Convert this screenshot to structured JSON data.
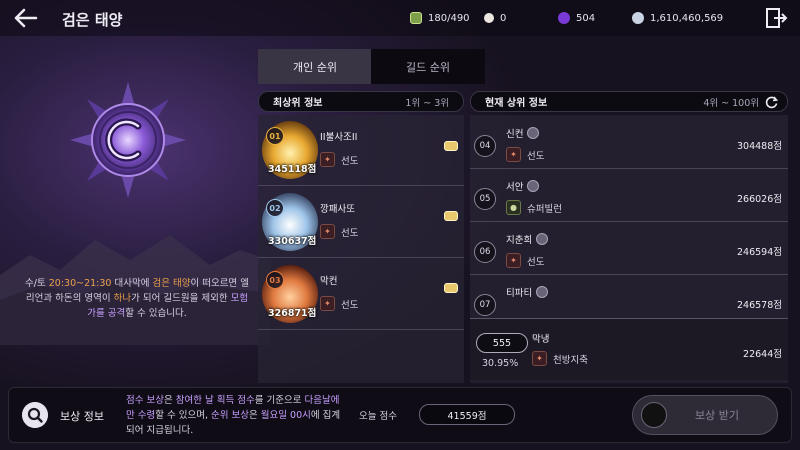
{
  "header": {
    "title": "검은 태양",
    "resources": [
      {
        "icon": "energy-icon",
        "value": "180/490"
      },
      {
        "icon": "pearl-icon",
        "value": "0"
      },
      {
        "icon": "gem-icon",
        "value": "504"
      },
      {
        "icon": "silver-icon",
        "value": "1,610,460,569"
      }
    ]
  },
  "description": {
    "line1a": "수/토 ",
    "time": "20:30~21:30",
    " line1c": "",
    "p1": "수/토 ",
    "p2": "20:30~21:30",
    "p3": " 대사막에 ",
    "p4": "검은 태양",
    "p5": "이 떠오르면 엘리언과 하돈의 영역이 ",
    "p6": "하나",
    "p7": "가 되어 길드원을 제외한 ",
    "p8": "모험가를 공격",
    "p9": "할 수 있습니다."
  },
  "tabs": [
    {
      "label": "개인 순위"
    },
    {
      "label": "길드 순위"
    }
  ],
  "top_panel": {
    "title": "최상위 정보",
    "range": "1위 ~ 3위"
  },
  "current_panel": {
    "title": "현재 상위 정보",
    "range": "4위 ~ 100위"
  },
  "top_ranks": [
    {
      "rank": "01",
      "name": "II불사조II",
      "points": "345118점",
      "class": "선도",
      "color": "#e8b040"
    },
    {
      "rank": "02",
      "name": "깡패사또",
      "points": "330637점",
      "class": "선도",
      "color": "#9ec4e8"
    },
    {
      "rank": "03",
      "name": "막컨",
      "points": "326871점",
      "class": "선도",
      "color": "#e07a40"
    }
  ],
  "current_ranks": [
    {
      "rank": "04",
      "name": "신컨",
      "class": "선도",
      "points": "304488점"
    },
    {
      "rank": "05",
      "name": "서안",
      "class": "슈퍼빌런",
      "points": "266026점"
    },
    {
      "rank": "06",
      "name": "지춘희",
      "class": "선도",
      "points": "246594점"
    },
    {
      "rank": "07",
      "name": "티파티",
      "class": "",
      "points": "246578점"
    }
  ],
  "my_rank": {
    "rank": "555",
    "percent": "30.95%",
    "name": "막냉",
    "class": "천방지축",
    "points": "22644점"
  },
  "bottom": {
    "title": "보상 정보",
    "d1": "점수 보상",
    "d2": "은 ",
    "d3": "참여한 날 획득 점수",
    "d4": "를 기준으로 ",
    "d5": "다음날에만 수령",
    "d6": "할 수 있으며, ",
    "d7": "순위 보상",
    "d8": "은 ",
    "d9": "월요일 00시",
    "d10": "에 집계되어 지급됩니다.",
    "today_label": "오늘 점수",
    "today_value": "41559점",
    "claim_label": "보상 받기"
  }
}
